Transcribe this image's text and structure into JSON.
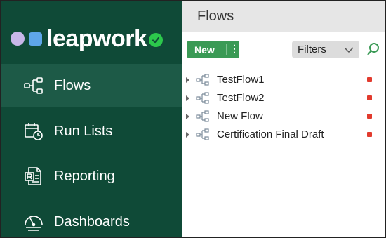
{
  "logo": {
    "text": "leapwork"
  },
  "sidebar": {
    "items": [
      {
        "label": "Flows",
        "icon": "flows-icon",
        "active": true
      },
      {
        "label": "Run Lists",
        "icon": "run-lists-icon",
        "active": false
      },
      {
        "label": "Reporting",
        "icon": "reporting-icon",
        "active": false
      },
      {
        "label": "Dashboards",
        "icon": "dashboards-icon",
        "active": false
      }
    ]
  },
  "main": {
    "title": "Flows",
    "toolbar": {
      "new_label": "New",
      "new_menu_glyph": "⋮",
      "filters_label": "Filters"
    },
    "flows": [
      {
        "name": "TestFlow1",
        "status_color": "#e23b2e"
      },
      {
        "name": "TestFlow2",
        "status_color": "#e23b2e"
      },
      {
        "name": "New Flow",
        "status_color": "#e23b2e"
      },
      {
        "name": "Certification Final Draft",
        "status_color": "#e23b2e"
      }
    ]
  },
  "colors": {
    "sidebar_bg": "#0f4a37",
    "sidebar_active": "#1d5a47",
    "accent_green": "#3a9a55",
    "status_red": "#e23b2e"
  }
}
